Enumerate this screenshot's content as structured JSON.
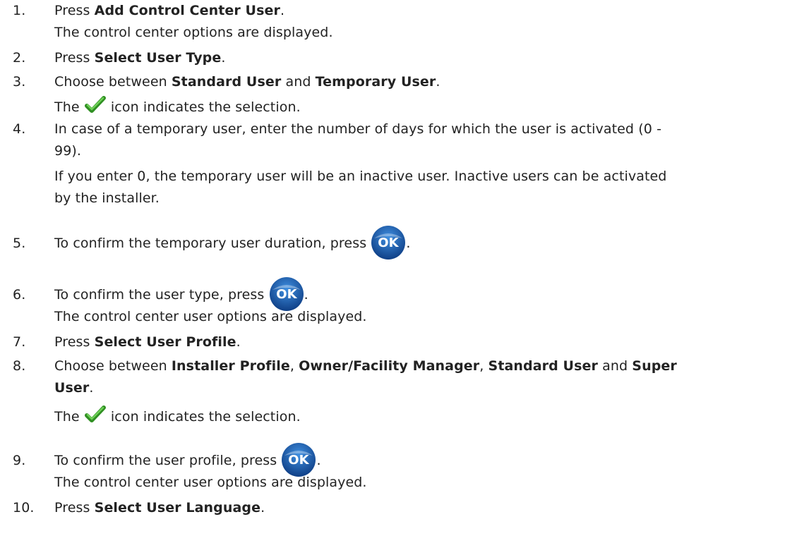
{
  "steps": [
    {
      "num": "1.",
      "pre": "Press ",
      "b1": "Add Control Center User",
      "post": "."
    },
    {
      "note": "The control center options are displayed."
    },
    {
      "num": "2.",
      "pre": "Press ",
      "b1": "Select User Type",
      "post": "."
    },
    {
      "num": "3.",
      "pre": "Choose between ",
      "b1": "Standard User",
      "mid": " and ",
      "b2": "Temporary User",
      "post": "."
    },
    {
      "note_pre": "The ",
      "note_post": " icon indicates the selection."
    },
    {
      "num": "4.",
      "line1": "In case of a temporary user, enter the number of days for which the user is activated (0 -",
      "line2": "99)."
    },
    {
      "note1": "If you enter 0, the temporary user will be an inactive user. Inactive users can be activated",
      "note2": "by the installer."
    },
    {
      "num": "5.",
      "pre": "To confirm the temporary user duration, press ",
      "post": "."
    },
    {
      "num": "6.",
      "pre": "To confirm the user type, press ",
      "post": "."
    },
    {
      "note": "The control center user options are displayed."
    },
    {
      "num": "7.",
      "pre": "Press ",
      "b1": "Select User Profile",
      "post": "."
    },
    {
      "num": "8.",
      "pre": "Choose between ",
      "b1": "Installer Profile",
      "s1": ", ",
      "b2": "Owner/Facility Manager",
      "s2": ", ",
      "b3": "Standard User",
      "s3": " and ",
      "b4": "Super",
      "b4b": "User",
      "post": "."
    },
    {
      "note_pre": "The ",
      "note_post": " icon indicates the selection."
    },
    {
      "num": "9.",
      "pre": "To confirm the user profile, press ",
      "post": "."
    },
    {
      "note": "The control center user options are displayed."
    },
    {
      "num": "10.",
      "pre": "Press ",
      "b1": "Select User Language",
      "post": "."
    }
  ],
  "icons": {
    "ok_label": "OK",
    "ok_color": "#1f5fae",
    "check_color": "#3da62b"
  }
}
